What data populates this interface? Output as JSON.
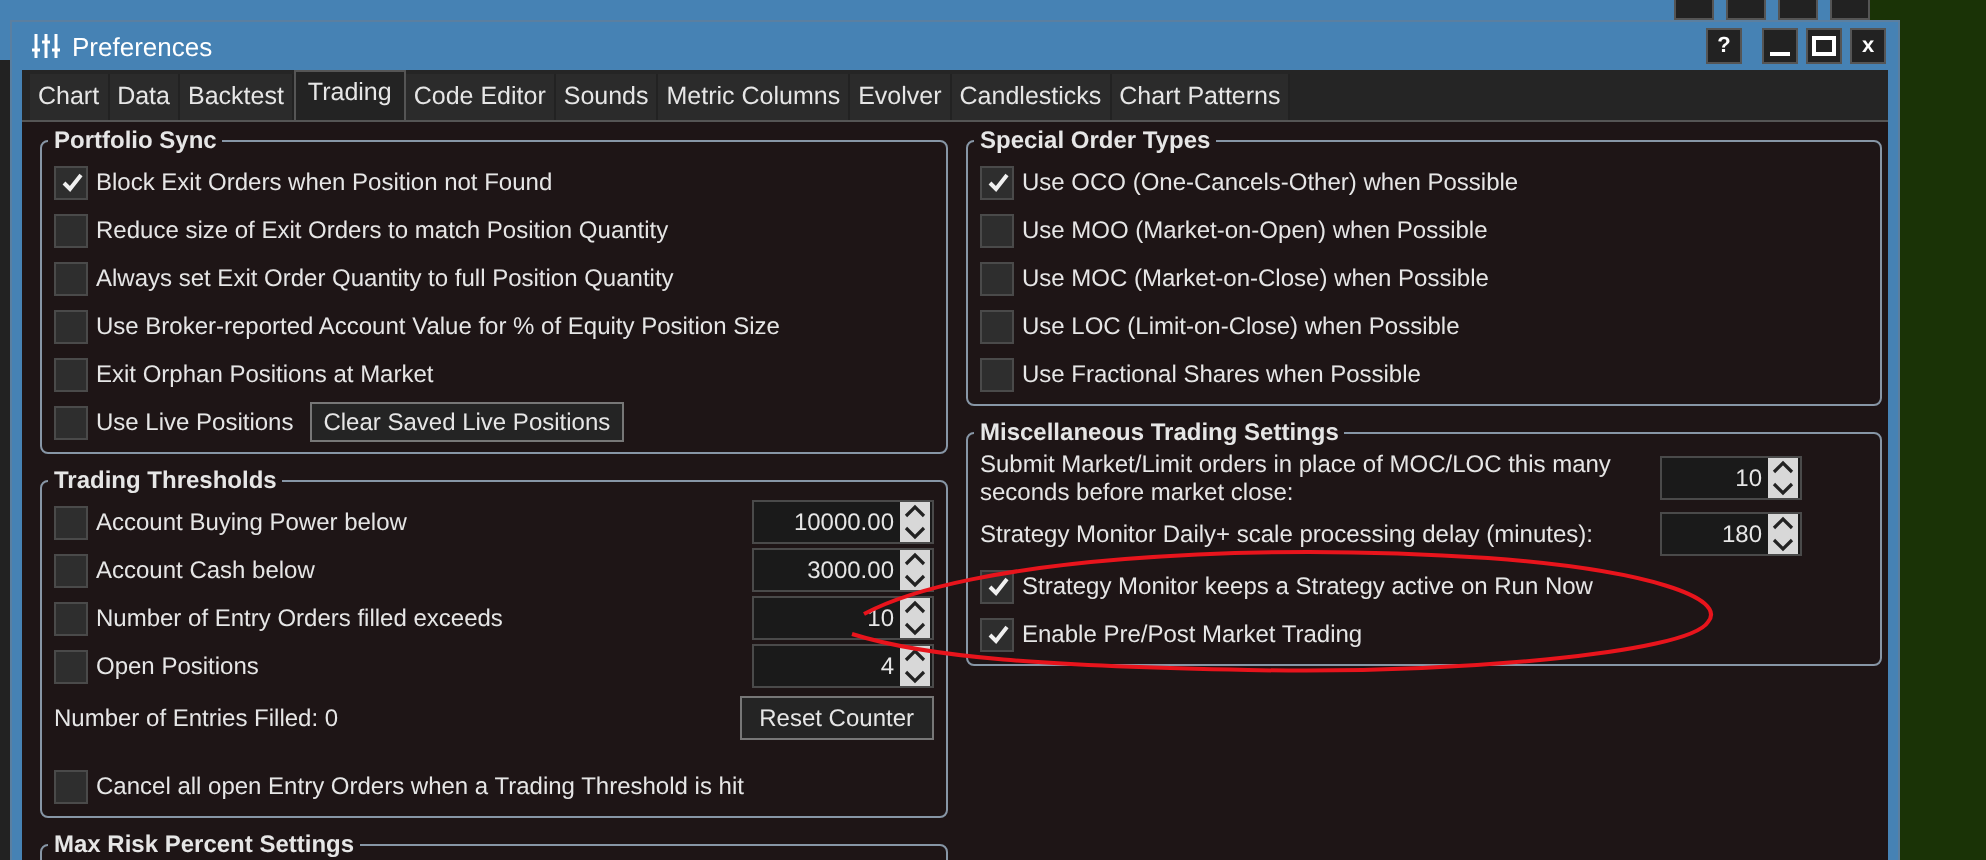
{
  "window": {
    "title": "Preferences",
    "help": "?",
    "close": "x"
  },
  "tabs": [
    {
      "label": "Chart",
      "selected": false
    },
    {
      "label": "Data",
      "selected": false
    },
    {
      "label": "Backtest",
      "selected": false
    },
    {
      "label": "Trading",
      "selected": true
    },
    {
      "label": "Code Editor",
      "selected": false
    },
    {
      "label": "Sounds",
      "selected": false
    },
    {
      "label": "Metric Columns",
      "selected": false
    },
    {
      "label": "Evolver",
      "selected": false
    },
    {
      "label": "Candlesticks",
      "selected": false
    },
    {
      "label": "Chart Patterns",
      "selected": false
    }
  ],
  "left_groups": [
    {
      "title": "Portfolio Sync",
      "rows": [
        {
          "kind": "checkbox",
          "label": "Block Exit Orders when Position not Found",
          "checked": true
        },
        {
          "kind": "checkbox",
          "label": "Reduce size of Exit Orders to match Position Quantity",
          "checked": false
        },
        {
          "kind": "checkbox",
          "label": "Always set Exit Order Quantity to full Position Quantity",
          "checked": false
        },
        {
          "kind": "checkbox",
          "label": "Use Broker-reported Account Value for % of Equity Position Size",
          "checked": false
        },
        {
          "kind": "checkbox",
          "label": "Exit Orphan Positions at Market",
          "checked": false
        },
        {
          "kind": "checkbox_button",
          "label": "Use Live Positions",
          "checked": false,
          "button": "Clear Saved Live Positions"
        }
      ]
    },
    {
      "title": "Trading Thresholds",
      "rows": [
        {
          "kind": "checkbox_spinner",
          "label": "Account Buying Power below",
          "checked": false,
          "value": "10000.00"
        },
        {
          "kind": "checkbox_spinner",
          "label": "Account Cash below",
          "checked": false,
          "value": "3000.00"
        },
        {
          "kind": "checkbox_spinner",
          "label": "Number of Entry Orders filled exceeds",
          "checked": false,
          "value": "10"
        },
        {
          "kind": "checkbox_spinner",
          "label": "Open Positions",
          "checked": false,
          "value": "4"
        },
        {
          "kind": "text_button",
          "label": "Number of Entries Filled: 0",
          "button": "Reset Counter"
        },
        {
          "kind": "checkbox",
          "label": "Cancel all open Entry Orders when a Trading Threshold is hit",
          "checked": false
        }
      ]
    },
    {
      "title": "Max Risk Percent Settings"
    }
  ],
  "right_groups": [
    {
      "title": "Special Order Types",
      "rows": [
        {
          "kind": "checkbox",
          "label": "Use OCO (One-Cancels-Other) when Possible",
          "checked": true
        },
        {
          "kind": "checkbox",
          "label": "Use MOO (Market-on-Open) when Possible",
          "checked": false
        },
        {
          "kind": "checkbox",
          "label": "Use MOC (Market-on-Close) when Possible",
          "checked": false
        },
        {
          "kind": "checkbox",
          "label": "Use LOC (Limit-on-Close) when Possible",
          "checked": false
        },
        {
          "kind": "checkbox",
          "label": "Use Fractional Shares when Possible",
          "checked": false
        }
      ]
    },
    {
      "title": "Miscellaneous Trading Settings",
      "rows": [
        {
          "kind": "text_spinner",
          "label": "Submit Market/Limit orders in place of MOC/LOC this many seconds before market close:",
          "value": "10"
        },
        {
          "kind": "text_spinner",
          "label": "Strategy Monitor Daily+ scale processing delay (minutes):",
          "value": "180"
        },
        {
          "kind": "checkbox",
          "label": "Strategy Monitor keeps a Strategy active on Run Now",
          "checked": true
        },
        {
          "kind": "checkbox",
          "label": "Enable Pre/Post Market Trading",
          "checked": true
        }
      ]
    }
  ]
}
